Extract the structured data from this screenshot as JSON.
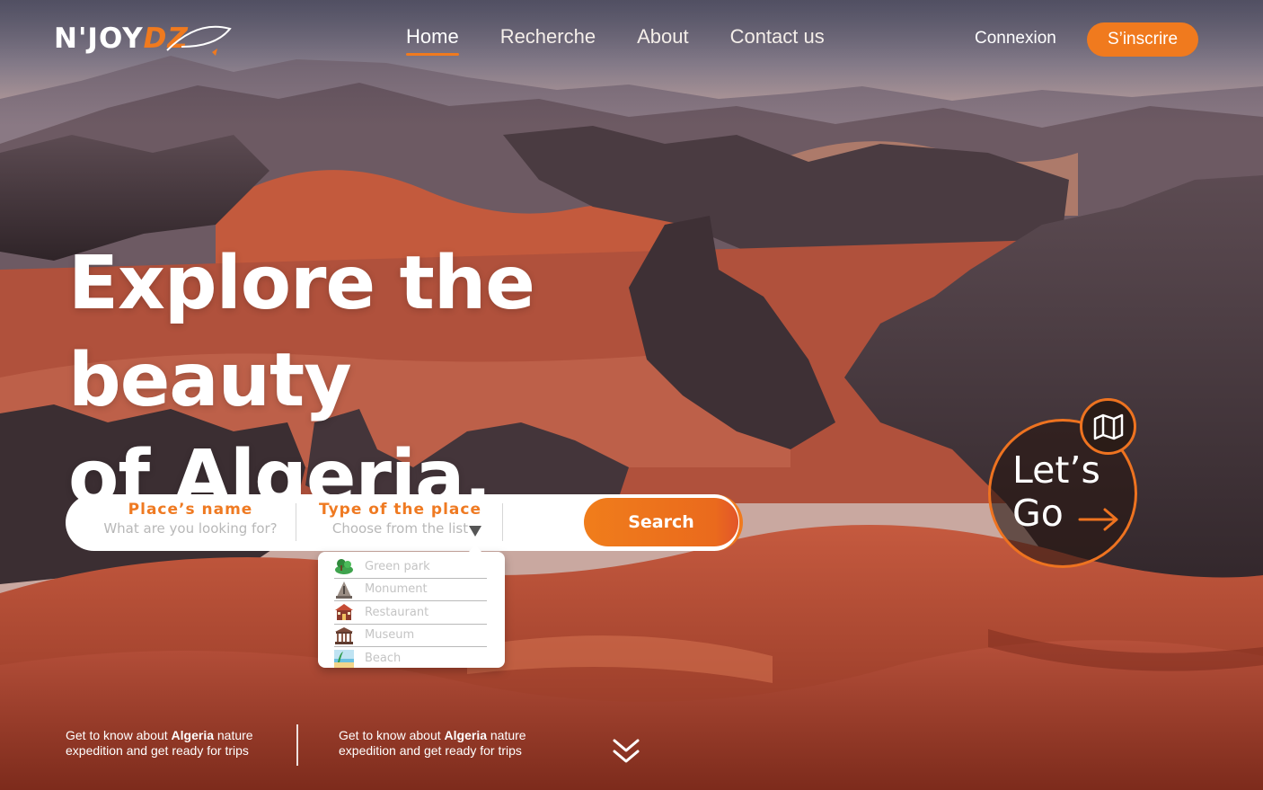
{
  "brand": {
    "logo_main": "N'JOY",
    "logo_accent": "DZ"
  },
  "nav": {
    "items": [
      {
        "label": "Home",
        "active": true
      },
      {
        "label": "Recherche",
        "active": false
      },
      {
        "label": "About",
        "active": false
      },
      {
        "label": "Contact us",
        "active": false
      }
    ],
    "login_label": "Connexion",
    "signup_label": "S’inscrire"
  },
  "hero": {
    "title_line1": "Explore the beauty",
    "title_line2": "of Algeria."
  },
  "search": {
    "place_label": "Place’s name",
    "place_placeholder": "What are you looking for?",
    "type_label": "Type of the place",
    "type_placeholder": "Choose from the list",
    "button_label": "Search"
  },
  "dropdown": {
    "options": [
      {
        "label": "Green park",
        "icon": "park-icon"
      },
      {
        "label": "Monument",
        "icon": "monument-icon"
      },
      {
        "label": "Restaurant",
        "icon": "restaurant-icon"
      },
      {
        "label": "Museum",
        "icon": "museum-icon"
      },
      {
        "label": "Beach",
        "icon": "beach-icon"
      }
    ]
  },
  "cta": {
    "line1": "Let’s",
    "line2": "Go",
    "icon": "map-icon"
  },
  "footer": {
    "blurb_prefix": "Get to know about",
    "blurb_highlight": "Algeria",
    "blurb_suffix": "nature expedition and get ready for trips"
  },
  "colors": {
    "accent": "#f07a1e",
    "placeholder": "#b8b8b8",
    "dropdown_text": "#c4c4c4"
  }
}
